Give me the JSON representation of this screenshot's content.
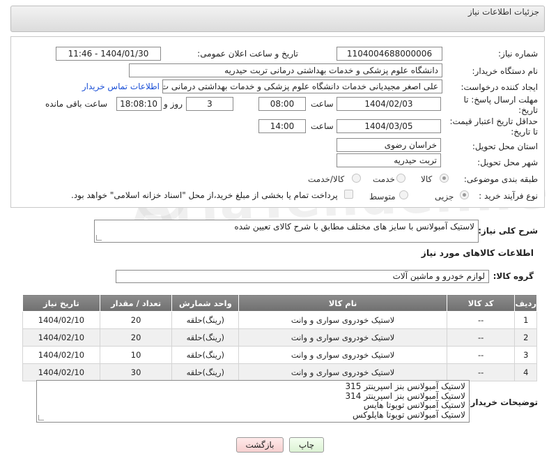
{
  "header": {
    "title": "جزئیات اطلاعات نیاز"
  },
  "form": {
    "need_number_label": "شماره نیاز:",
    "need_number": "1104004688000006",
    "announce_label": "تاریخ و ساعت اعلان عمومی:",
    "announce_value": "1404/01/30 - 11:46",
    "buyer_org_label": "نام دستگاه خریدار:",
    "buyer_org": "دانشگاه علوم پزشکی و خدمات بهداشتی درمانی تربت حیدریه",
    "creator_label": "ایجاد کننده درخواست:",
    "creator": "علی اصغر مجیدیانی خدمات دانشگاه علوم پزشکی و خدمات بهداشتی درمانی ت",
    "contact_link": "اطلاعات تماس خریدار",
    "deadline_label_1": "مهلت ارسال پاسخ: تا",
    "deadline_label_2": "تاریخ:",
    "deadline_date": "1404/02/03",
    "time_label": "ساعت",
    "deadline_time": "08:00",
    "days_value": "3",
    "days_label": "روز و",
    "remaining_time": "18:08:10",
    "remaining_label": "ساعت باقی مانده",
    "validity_label_1": "حداقل تاریخ اعتبار قیمت:",
    "validity_label_2": "تا تاریخ:",
    "validity_date": "1404/03/05",
    "validity_time": "14:00",
    "province_label": "استان محل تحویل:",
    "province": "خراسان رضوی",
    "city_label": "شهر محل تحویل:",
    "city": "تربت حیدریه",
    "category_label": "طبقه بندی موضوعی:",
    "category_options": [
      "کالا",
      "خدمت",
      "کالا/خدمت"
    ],
    "category_selected": "کالا",
    "process_label": "نوع فرآیند خرید :",
    "process_options": [
      "جزیی",
      "متوسط"
    ],
    "process_selected": "جزیی",
    "payment_note": "پرداخت تمام یا بخشی از مبلغ خرید،از محل \"اسناد خزانه اسلامی\" خواهد بود."
  },
  "description": {
    "label": "شرح کلی نیاز:",
    "text": "لاستیک آمبولانس با سایز های مختلف مطابق با شرح کالای تعیین شده"
  },
  "goods_section": {
    "title": "اطلاعات کالاهای مورد نیاز",
    "group_label": "گروه کالا:",
    "group_value": "لوازم خودرو و ماشین آلات"
  },
  "table": {
    "headers": [
      "ردیف",
      "کد کالا",
      "نام کالا",
      "واحد شمارش",
      "تعداد / مقدار",
      "تاریخ نیاز"
    ],
    "rows": [
      [
        "1",
        "--",
        "لاستیک خودروی سواری و وانت",
        "(رینگ)حلقه",
        "20",
        "1404/02/10"
      ],
      [
        "2",
        "--",
        "لاستیک خودروی سواری و وانت",
        "(رینگ)حلقه",
        "20",
        "1404/02/10"
      ],
      [
        "3",
        "--",
        "لاستیک خودروی سواری و وانت",
        "(رینگ)حلقه",
        "10",
        "1404/02/10"
      ],
      [
        "4",
        "--",
        "لاستیک خودروی سواری و وانت",
        "(رینگ)حلقه",
        "30",
        "1404/02/10"
      ]
    ]
  },
  "buyer_notes": {
    "label": "توضیحات خریدار:",
    "lines": [
      "لاستیک آمبولانس بنز اسپرینتر 315",
      "لاستیک آمبولانس بنز اسپرینتر 314",
      "لاستیک آمبولانس تویوتا هایس",
      "لاستیک آمبولانس تویوتا هایلوکس"
    ]
  },
  "buttons": {
    "print": "چاپ",
    "back": "بازگشت"
  },
  "watermark": {
    "text": "AriaTender.net"
  }
}
